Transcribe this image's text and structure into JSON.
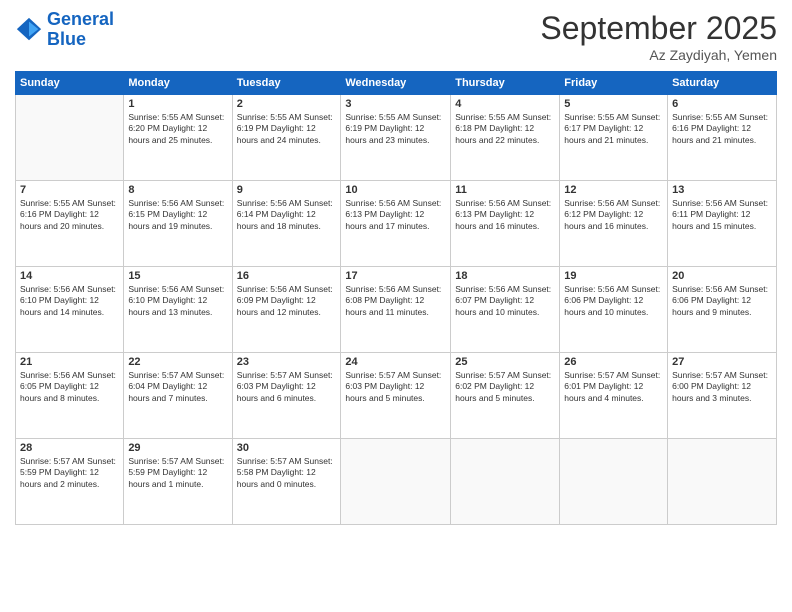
{
  "logo": {
    "line1": "General",
    "line2": "Blue"
  },
  "title": "September 2025",
  "subtitle": "Az Zaydiyah, Yemen",
  "days_of_week": [
    "Sunday",
    "Monday",
    "Tuesday",
    "Wednesday",
    "Thursday",
    "Friday",
    "Saturday"
  ],
  "weeks": [
    [
      {
        "num": "",
        "info": ""
      },
      {
        "num": "1",
        "info": "Sunrise: 5:55 AM\nSunset: 6:20 PM\nDaylight: 12 hours\nand 25 minutes."
      },
      {
        "num": "2",
        "info": "Sunrise: 5:55 AM\nSunset: 6:19 PM\nDaylight: 12 hours\nand 24 minutes."
      },
      {
        "num": "3",
        "info": "Sunrise: 5:55 AM\nSunset: 6:19 PM\nDaylight: 12 hours\nand 23 minutes."
      },
      {
        "num": "4",
        "info": "Sunrise: 5:55 AM\nSunset: 6:18 PM\nDaylight: 12 hours\nand 22 minutes."
      },
      {
        "num": "5",
        "info": "Sunrise: 5:55 AM\nSunset: 6:17 PM\nDaylight: 12 hours\nand 21 minutes."
      },
      {
        "num": "6",
        "info": "Sunrise: 5:55 AM\nSunset: 6:16 PM\nDaylight: 12 hours\nand 21 minutes."
      }
    ],
    [
      {
        "num": "7",
        "info": "Sunrise: 5:55 AM\nSunset: 6:16 PM\nDaylight: 12 hours\nand 20 minutes."
      },
      {
        "num": "8",
        "info": "Sunrise: 5:56 AM\nSunset: 6:15 PM\nDaylight: 12 hours\nand 19 minutes."
      },
      {
        "num": "9",
        "info": "Sunrise: 5:56 AM\nSunset: 6:14 PM\nDaylight: 12 hours\nand 18 minutes."
      },
      {
        "num": "10",
        "info": "Sunrise: 5:56 AM\nSunset: 6:13 PM\nDaylight: 12 hours\nand 17 minutes."
      },
      {
        "num": "11",
        "info": "Sunrise: 5:56 AM\nSunset: 6:13 PM\nDaylight: 12 hours\nand 16 minutes."
      },
      {
        "num": "12",
        "info": "Sunrise: 5:56 AM\nSunset: 6:12 PM\nDaylight: 12 hours\nand 16 minutes."
      },
      {
        "num": "13",
        "info": "Sunrise: 5:56 AM\nSunset: 6:11 PM\nDaylight: 12 hours\nand 15 minutes."
      }
    ],
    [
      {
        "num": "14",
        "info": "Sunrise: 5:56 AM\nSunset: 6:10 PM\nDaylight: 12 hours\nand 14 minutes."
      },
      {
        "num": "15",
        "info": "Sunrise: 5:56 AM\nSunset: 6:10 PM\nDaylight: 12 hours\nand 13 minutes."
      },
      {
        "num": "16",
        "info": "Sunrise: 5:56 AM\nSunset: 6:09 PM\nDaylight: 12 hours\nand 12 minutes."
      },
      {
        "num": "17",
        "info": "Sunrise: 5:56 AM\nSunset: 6:08 PM\nDaylight: 12 hours\nand 11 minutes."
      },
      {
        "num": "18",
        "info": "Sunrise: 5:56 AM\nSunset: 6:07 PM\nDaylight: 12 hours\nand 10 minutes."
      },
      {
        "num": "19",
        "info": "Sunrise: 5:56 AM\nSunset: 6:06 PM\nDaylight: 12 hours\nand 10 minutes."
      },
      {
        "num": "20",
        "info": "Sunrise: 5:56 AM\nSunset: 6:06 PM\nDaylight: 12 hours\nand 9 minutes."
      }
    ],
    [
      {
        "num": "21",
        "info": "Sunrise: 5:56 AM\nSunset: 6:05 PM\nDaylight: 12 hours\nand 8 minutes."
      },
      {
        "num": "22",
        "info": "Sunrise: 5:57 AM\nSunset: 6:04 PM\nDaylight: 12 hours\nand 7 minutes."
      },
      {
        "num": "23",
        "info": "Sunrise: 5:57 AM\nSunset: 6:03 PM\nDaylight: 12 hours\nand 6 minutes."
      },
      {
        "num": "24",
        "info": "Sunrise: 5:57 AM\nSunset: 6:03 PM\nDaylight: 12 hours\nand 5 minutes."
      },
      {
        "num": "25",
        "info": "Sunrise: 5:57 AM\nSunset: 6:02 PM\nDaylight: 12 hours\nand 5 minutes."
      },
      {
        "num": "26",
        "info": "Sunrise: 5:57 AM\nSunset: 6:01 PM\nDaylight: 12 hours\nand 4 minutes."
      },
      {
        "num": "27",
        "info": "Sunrise: 5:57 AM\nSunset: 6:00 PM\nDaylight: 12 hours\nand 3 minutes."
      }
    ],
    [
      {
        "num": "28",
        "info": "Sunrise: 5:57 AM\nSunset: 5:59 PM\nDaylight: 12 hours\nand 2 minutes."
      },
      {
        "num": "29",
        "info": "Sunrise: 5:57 AM\nSunset: 5:59 PM\nDaylight: 12 hours\nand 1 minute."
      },
      {
        "num": "30",
        "info": "Sunrise: 5:57 AM\nSunset: 5:58 PM\nDaylight: 12 hours\nand 0 minutes."
      },
      {
        "num": "",
        "info": ""
      },
      {
        "num": "",
        "info": ""
      },
      {
        "num": "",
        "info": ""
      },
      {
        "num": "",
        "info": ""
      }
    ]
  ]
}
